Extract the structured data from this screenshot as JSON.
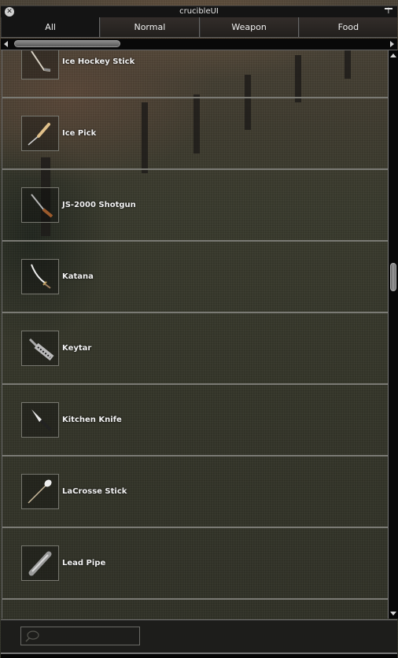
{
  "window": {
    "title": "crucibleUI",
    "close_icon": "close-icon",
    "pin_icon": "pin-top-icon"
  },
  "tabs": [
    {
      "label": "All",
      "active": true
    },
    {
      "label": "Normal",
      "active": false
    },
    {
      "label": "Weapon",
      "active": false
    },
    {
      "label": "Food",
      "active": false
    }
  ],
  "items": [
    {
      "name": "Ice Hockey Stick",
      "icon": "ice-hockey-stick-icon"
    },
    {
      "name": "Ice Pick",
      "icon": "ice-pick-icon"
    },
    {
      "name": "JS-2000 Shotgun",
      "icon": "shotgun-icon"
    },
    {
      "name": "Katana",
      "icon": "katana-icon"
    },
    {
      "name": "Keytar",
      "icon": "keytar-icon"
    },
    {
      "name": "Kitchen Knife",
      "icon": "kitchen-knife-icon"
    },
    {
      "name": "LaCrosse Stick",
      "icon": "lacrosse-stick-icon"
    },
    {
      "name": "Lead Pipe",
      "icon": "lead-pipe-icon"
    }
  ],
  "search": {
    "value": "",
    "placeholder": "",
    "icon": "search-icon"
  }
}
